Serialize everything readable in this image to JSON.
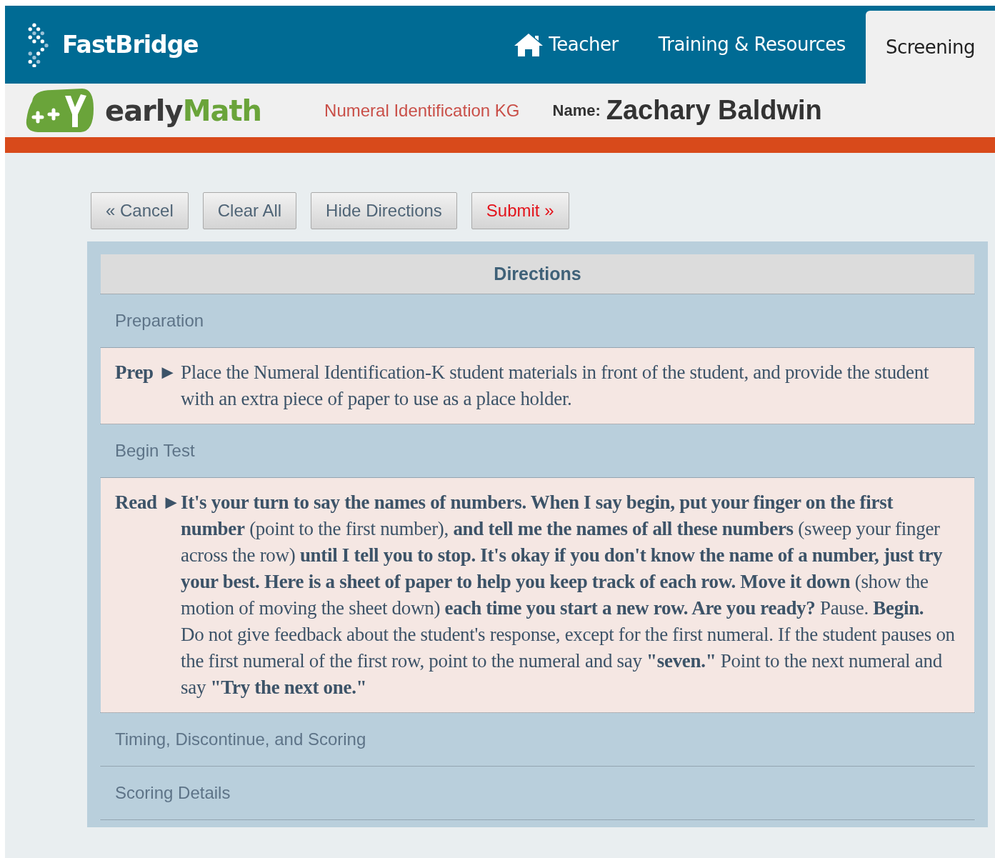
{
  "header": {
    "brand": "FastBridge",
    "nav": [
      {
        "label": "Teacher",
        "kind": "icon_link",
        "selected": false
      },
      {
        "label": "Training & Resources",
        "kind": "text_link",
        "selected": false
      },
      {
        "label": "Screening",
        "kind": "text_link",
        "selected": true
      }
    ]
  },
  "subheader": {
    "product": [
      "early",
      "Math"
    ],
    "assessment": "Numeral Identification KG",
    "name_label": "Name:",
    "student_name": "Zachary Baldwin"
  },
  "buttons": [
    {
      "label": "« Cancel",
      "kind": "normal"
    },
    {
      "label": "Clear All",
      "kind": "normal"
    },
    {
      "label": "Hide Directions",
      "kind": "normal"
    },
    {
      "label": "Submit »",
      "kind": "submit"
    }
  ],
  "directions": {
    "title": "Directions",
    "sections": [
      {
        "kind": "heading",
        "text": "Preparation"
      },
      {
        "kind": "step",
        "label": "Prep",
        "marker": "►",
        "paragraphs": [
          "Place the Numeral Identification-K student materials in front of the student, and provide the student with an extra piece of paper to use as a place holder."
        ]
      },
      {
        "kind": "heading",
        "text": "Begin Test"
      },
      {
        "kind": "step",
        "label": "Read",
        "marker": "►",
        "paragraphs": [
          "**It's your turn to say the names of numbers. When I say begin, put your finger on the first number** (point to the first number), **and tell me the names of all these numbers** (sweep your finger across the row) **until I tell you to stop. It's okay if you don't know the name of a number, just try your best. Here is a sheet of paper to help you keep track of each row. Move it down** (show the motion of moving the sheet down) **each time you start a new row. Are you ready?** Pause. **Begin.**",
          "Do not give feedback about the student's response, except for the first numeral. If the student pauses on the first numeral of the first row, point to the numeral and say **\"seven.\"** Point to the next numeral and say **\"Try the next one.\"**"
        ]
      },
      {
        "kind": "heading",
        "text": "Timing, Discontinue, and Scoring"
      },
      {
        "kind": "heading",
        "text": "Scoring Details"
      }
    ]
  }
}
